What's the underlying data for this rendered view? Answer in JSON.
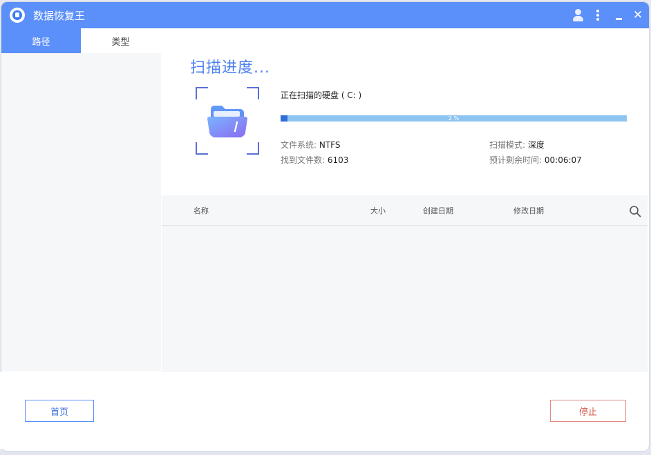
{
  "window": {
    "title": "数据恢复王",
    "accent_color": "#5b8ff9"
  },
  "titlebar_icons": [
    "user-icon",
    "more-vertical-icon",
    "minimize-icon",
    "close-icon"
  ],
  "tabs": [
    {
      "label": "路径",
      "active": true
    },
    {
      "label": "类型",
      "active": false
    }
  ],
  "scan": {
    "title": "扫描进度...",
    "drive_label": "正在扫描的硬盘 ( C: )",
    "progress_percent": 2,
    "progress_text": "2 %",
    "file_system_label": "文件系统:",
    "file_system_value": "NTFS",
    "files_found_label": "找到文件数:",
    "files_found_value": "6103",
    "scan_mode_label": "扫描模式:",
    "scan_mode_value": "深度",
    "time_left_label": "预计剩余时间:",
    "time_left_value": "00:06:07"
  },
  "table": {
    "columns": [
      "名称",
      "大小",
      "创建日期",
      "修改日期"
    ],
    "rows": []
  },
  "buttons": {
    "home": "首页",
    "stop": "停止"
  }
}
